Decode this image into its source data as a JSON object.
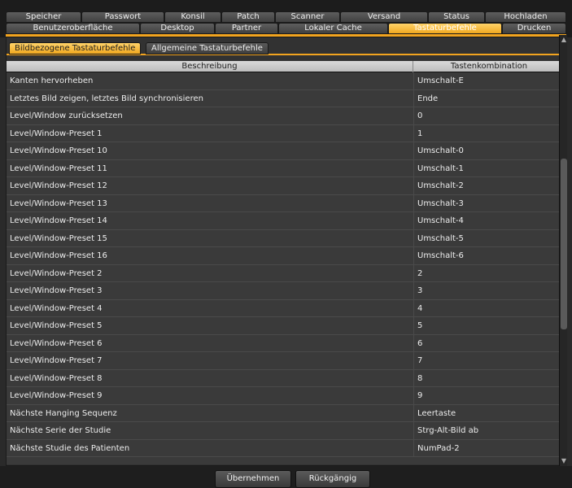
{
  "tabs": {
    "row1": [
      "Speicher",
      "Passwort",
      "Konsil",
      "Patch",
      "Scanner",
      "Versand",
      "Status",
      "Hochladen"
    ],
    "row2": [
      "Benutzeroberfläche",
      "Desktop",
      "Partner",
      "Lokaler Cache",
      "Tastaturbefehle",
      "Drucken"
    ],
    "active": "Tastaturbefehle"
  },
  "subtabs": {
    "items": [
      "Bildbezogene Tastaturbefehle",
      "Allgemeine Tastaturbefehle"
    ],
    "active": "Bildbezogene Tastaturbefehle"
  },
  "table": {
    "headers": {
      "desc": "Beschreibung",
      "key": "Tastenkombination"
    },
    "rows": [
      {
        "desc": "Kanten hervorheben",
        "key": "Umschalt-E"
      },
      {
        "desc": "Letztes Bild zeigen, letztes Bild synchronisieren",
        "key": "Ende"
      },
      {
        "desc": "Level/Window zurücksetzen",
        "key": "0"
      },
      {
        "desc": "Level/Window-Preset 1",
        "key": "1"
      },
      {
        "desc": "Level/Window-Preset 10",
        "key": "Umschalt-0"
      },
      {
        "desc": "Level/Window-Preset 11",
        "key": "Umschalt-1"
      },
      {
        "desc": "Level/Window-Preset 12",
        "key": "Umschalt-2"
      },
      {
        "desc": "Level/Window-Preset 13",
        "key": "Umschalt-3"
      },
      {
        "desc": "Level/Window-Preset 14",
        "key": "Umschalt-4"
      },
      {
        "desc": "Level/Window-Preset 15",
        "key": "Umschalt-5"
      },
      {
        "desc": "Level/Window-Preset 16",
        "key": "Umschalt-6"
      },
      {
        "desc": "Level/Window-Preset 2",
        "key": "2"
      },
      {
        "desc": "Level/Window-Preset 3",
        "key": "3"
      },
      {
        "desc": "Level/Window-Preset 4",
        "key": "4"
      },
      {
        "desc": "Level/Window-Preset 5",
        "key": "5"
      },
      {
        "desc": "Level/Window-Preset 6",
        "key": "6"
      },
      {
        "desc": "Level/Window-Preset 7",
        "key": "7"
      },
      {
        "desc": "Level/Window-Preset 8",
        "key": "8"
      },
      {
        "desc": "Level/Window-Preset 9",
        "key": "9"
      },
      {
        "desc": "Nächste Hanging Sequenz",
        "key": "Leertaste"
      },
      {
        "desc": "Nächste Serie der Studie",
        "key": "Strg-Alt-Bild ab"
      },
      {
        "desc": "Nächste Studie des Patienten",
        "key": "NumPad-2"
      }
    ]
  },
  "scrollbar": {
    "up_icon": "chevron-up-icon",
    "down_icon": "chevron-down-icon"
  },
  "footer": {
    "apply_label": "Übernehmen",
    "undo_label": "Rückgängig"
  },
  "colors": {
    "accent": "#f2a41f",
    "background": "#2a2a2a",
    "row": "#3a3a3a"
  }
}
